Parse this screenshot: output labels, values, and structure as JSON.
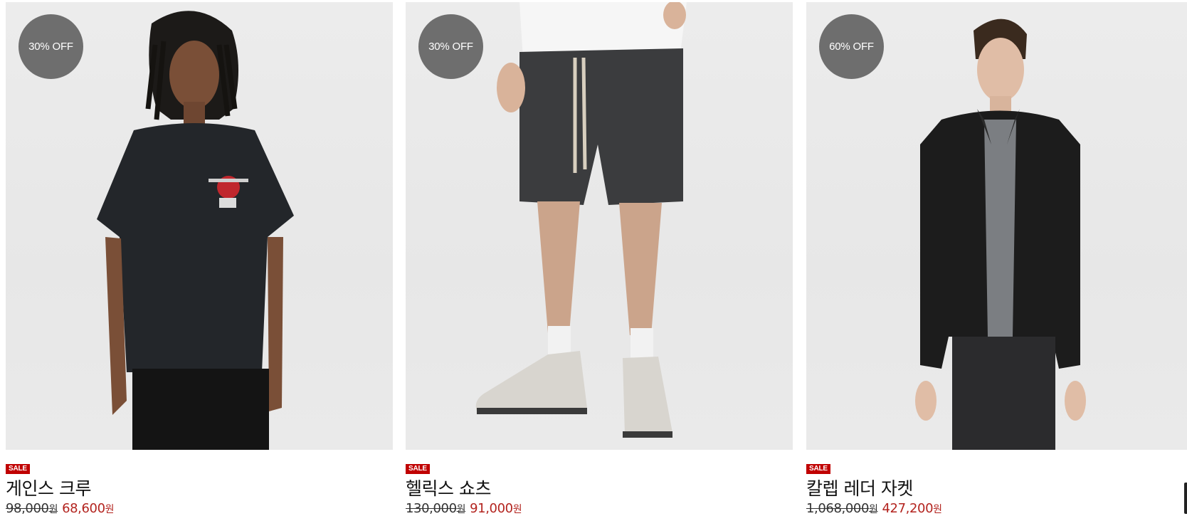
{
  "products": [
    {
      "discount_badge": "30% OFF",
      "sale_label": "SALE",
      "name": "게인스 크루",
      "original_price": "98,000",
      "sale_price": "68,600",
      "currency": "원",
      "image_subject": "black-tshirt-model"
    },
    {
      "discount_badge": "30% OFF",
      "sale_label": "SALE",
      "name": "헬릭스 쇼츠",
      "original_price": "130,000",
      "sale_price": "91,000",
      "currency": "원",
      "image_subject": "grey-shorts-model"
    },
    {
      "discount_badge": "60% OFF",
      "sale_label": "SALE",
      "name": "칼렙 레더 자켓",
      "original_price": "1,068,000",
      "sale_price": "427,200",
      "currency": "원",
      "image_subject": "leather-jacket-model"
    }
  ],
  "colors": {
    "badge_bg": "#6e6e6e",
    "sale_red": "#c00000",
    "price_red": "#b3241f",
    "photo_bg": "#e9e9e9"
  }
}
